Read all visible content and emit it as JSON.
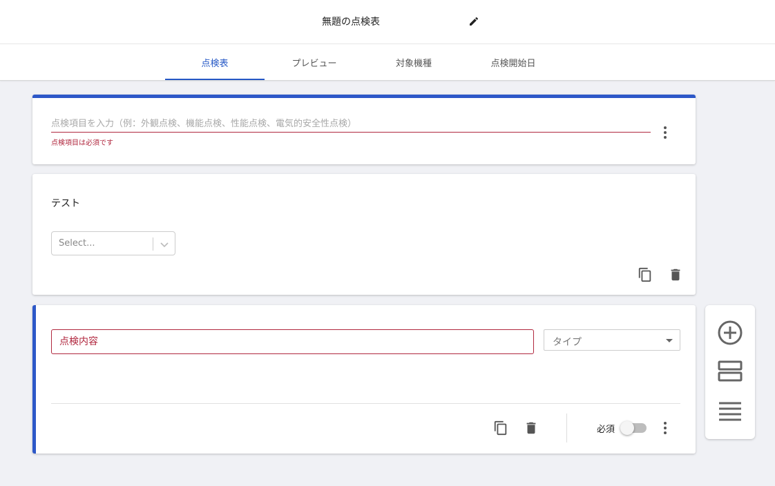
{
  "header": {
    "title": "無題の点検表",
    "edit_icon": "pencil-icon"
  },
  "tabs": [
    {
      "label": "点検表",
      "active": true
    },
    {
      "label": "プレビュー",
      "active": false
    },
    {
      "label": "対象機種",
      "active": false
    },
    {
      "label": "点検開始日",
      "active": false
    }
  ],
  "section_card": {
    "placeholder": "点検項目を入力（例：外観点検、機能点検、性能点検、電気的安全性点検）",
    "error": "点検項目は必須です"
  },
  "question_card": {
    "label": "テスト",
    "select_placeholder": "Select..."
  },
  "edit_card": {
    "content_value": "点検内容",
    "type_placeholder": "タイプ",
    "required_label": "必須",
    "required_on": false
  },
  "colors": {
    "accent": "#2d58c8",
    "error": "#b0263d",
    "tab_active": "#2457c5"
  }
}
